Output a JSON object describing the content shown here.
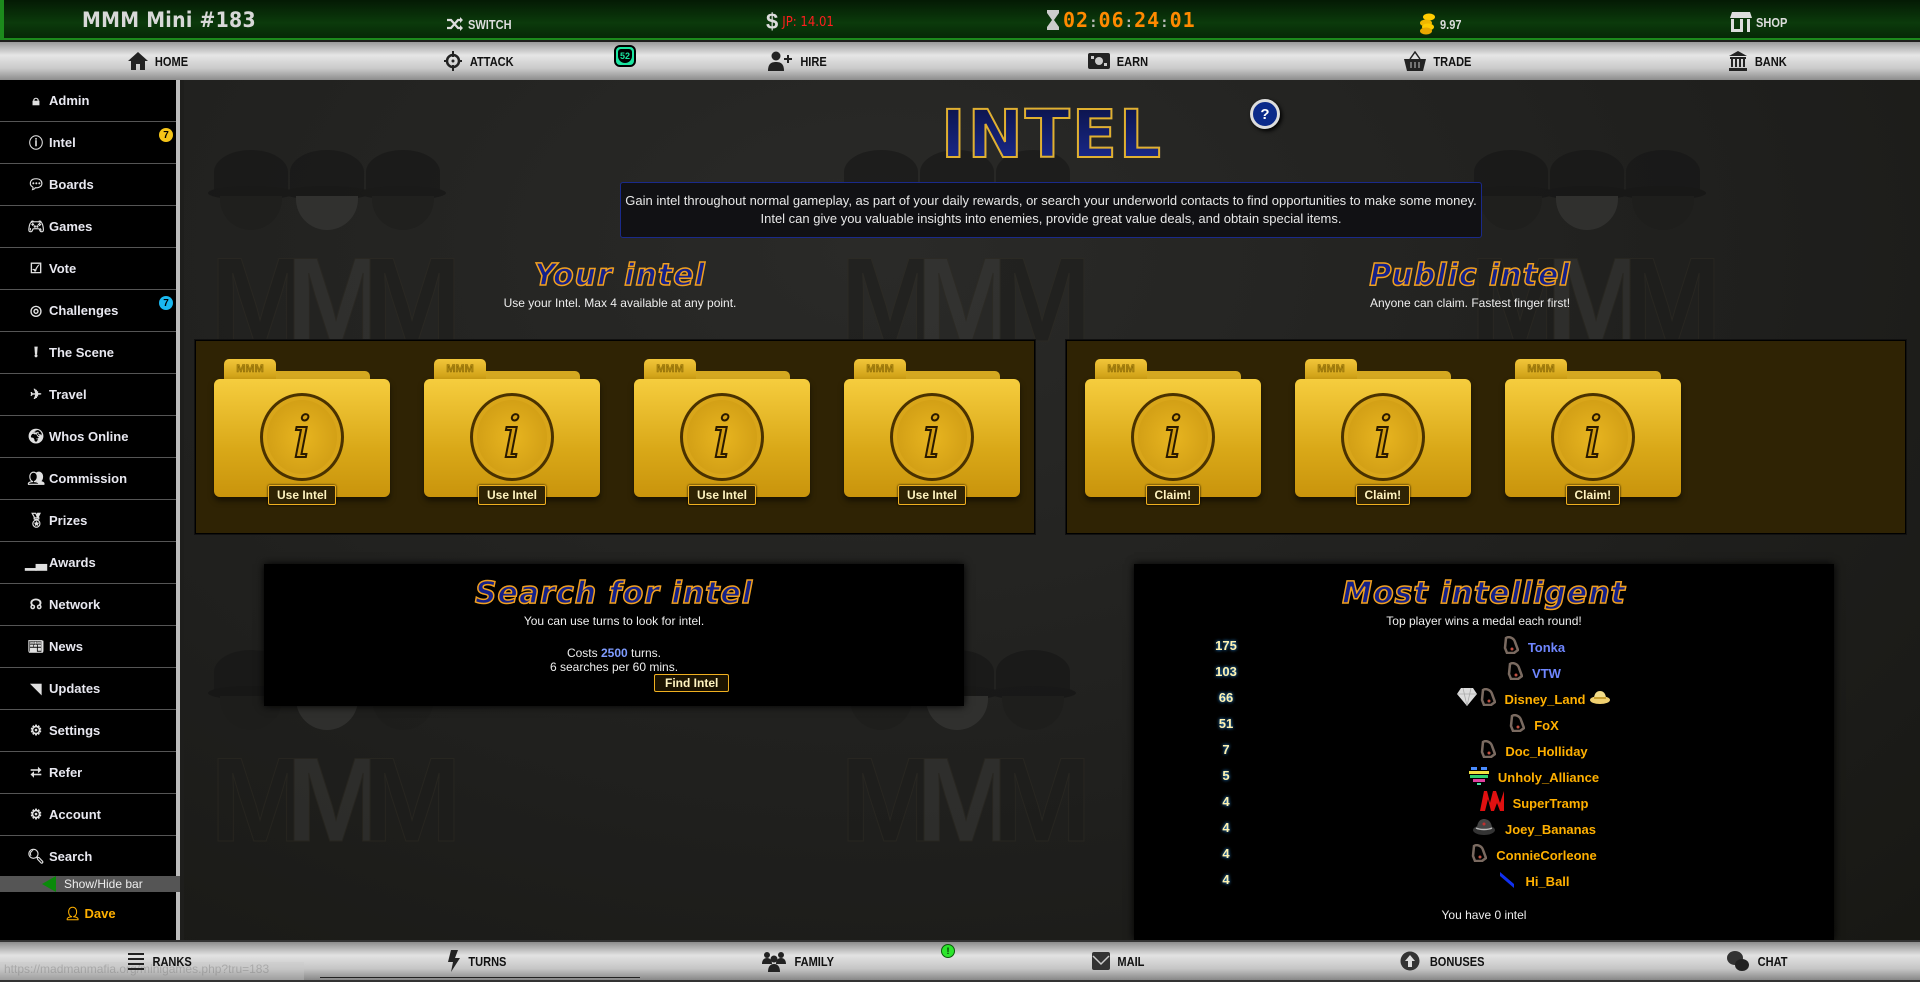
{
  "topbar": {
    "title": "MMM Mini #183",
    "switch_label": "SWITCH",
    "jackpot": "JP: 14.01",
    "timer": [
      "02",
      "06",
      "24",
      "01"
    ],
    "coins": "9.97",
    "shop_label": "SHOP"
  },
  "nav": {
    "items": [
      {
        "label": "HOME",
        "icon": "home-icon"
      },
      {
        "label": "ATTACK",
        "icon": "crosshair-icon"
      },
      {
        "label": "HIRE",
        "icon": "user-plus-icon"
      },
      {
        "label": "EARN",
        "icon": "money-icon"
      },
      {
        "label": "TRADE",
        "icon": "basket-icon"
      },
      {
        "label": "BANK",
        "icon": "bank-icon"
      }
    ],
    "attack_badge": "52"
  },
  "sidebar": {
    "items": [
      {
        "label": "Admin",
        "icon": "lock-icon"
      },
      {
        "label": "Intel",
        "icon": "info-icon",
        "badge": "7",
        "badge_color": "#f5c518"
      },
      {
        "label": "Boards",
        "icon": "speech-bubble-icon"
      },
      {
        "label": "Games",
        "icon": "gamepad-icon"
      },
      {
        "label": "Vote",
        "icon": "vote-box-icon"
      },
      {
        "label": "Challenges",
        "icon": "target-icon",
        "badge": "7",
        "badge_color": "#1ab8f0"
      },
      {
        "label": "The Scene",
        "icon": "exclamation-icon"
      },
      {
        "label": "Travel",
        "icon": "plane-icon"
      },
      {
        "label": "Whos Online",
        "icon": "globe-icon"
      },
      {
        "label": "Commission",
        "icon": "users-icon"
      },
      {
        "label": "Prizes",
        "icon": "medal-icon"
      },
      {
        "label": "Awards",
        "icon": "podium-icon"
      },
      {
        "label": "Network",
        "icon": "network-icon"
      },
      {
        "label": "News",
        "icon": "newspaper-icon"
      },
      {
        "label": "Updates",
        "icon": "rss-icon"
      },
      {
        "label": "Settings",
        "icon": "user-gear-icon"
      },
      {
        "label": "Refer",
        "icon": "share-icon"
      },
      {
        "label": "Account",
        "icon": "user-gear-icon"
      },
      {
        "label": "Search",
        "icon": "search-icon"
      }
    ],
    "toggle_label": "Show/Hide bar",
    "username": "Dave"
  },
  "main": {
    "title": "INTEL",
    "help": "?",
    "description": [
      "Gain intel throughout normal gameplay, as part of your daily rewards, or search your underworld contacts to find opportunities to make some money.",
      "Intel can give you valuable insights into enemies, provide great value deals, and obtain special items."
    ],
    "your_intel": {
      "title": "Your intel",
      "subtitle": "Use your Intel. Max 4 available at any point.",
      "folders": [
        {
          "tab": "MMM",
          "button": "Use Intel"
        },
        {
          "tab": "MMM",
          "button": "Use Intel"
        },
        {
          "tab": "MMM",
          "button": "Use Intel"
        },
        {
          "tab": "MMM",
          "button": "Use Intel"
        }
      ]
    },
    "public_intel": {
      "title": "Public intel",
      "subtitle": "Anyone can claim. Fastest finger first!",
      "folders": [
        {
          "tab": "MMM",
          "button": "Claim!"
        },
        {
          "tab": "MMM",
          "button": "Claim!"
        },
        {
          "tab": "MMM",
          "button": "Claim!"
        }
      ]
    },
    "search": {
      "title": "Search for intel",
      "subtitle": "You can use turns to look for intel.",
      "cost_prefix": "Costs ",
      "cost_value": "2500",
      "cost_suffix": " turns.",
      "rate": "6 searches per 60 mins.",
      "button": "Find Intel"
    },
    "leaderboard": {
      "title": "Most intelligent",
      "subtitle": "Top player wins a medal each round!",
      "rows": [
        {
          "score": "175",
          "name": "Tonka",
          "color": "#6f86ff",
          "icons": [
            "knuckles-icon"
          ]
        },
        {
          "score": "103",
          "name": "VTW",
          "color": "#6f86ff",
          "icons": [
            "knuckles-icon"
          ]
        },
        {
          "score": "66",
          "name": "Disney_Land",
          "color": "#ffb000",
          "icons": [
            "diamond-icon",
            "knuckles-icon"
          ],
          "suffix_icon": "fedora-icon"
        },
        {
          "score": "51",
          "name": "FoX",
          "color": "#ffb000",
          "icons": [
            "knuckles-icon"
          ]
        },
        {
          "score": "7",
          "name": "Doc_Holliday",
          "color": "#ffb000",
          "icons": [
            "knuckles-icon"
          ]
        },
        {
          "score": "5",
          "name": "Unholy_Alliance",
          "color": "#ffb000",
          "icons": [
            "pixel-heart-icon"
          ]
        },
        {
          "score": "4",
          "name": "SuperTramp",
          "color": "#ffb000",
          "icons": [
            "red-logo-icon"
          ]
        },
        {
          "score": "4",
          "name": "Joey_Bananas",
          "color": "#ffb000",
          "icons": [
            "hat-icon"
          ]
        },
        {
          "score": "4",
          "name": "ConnieCorleone",
          "color": "#ffb000",
          "icons": [
            "knuckles-icon"
          ]
        },
        {
          "score": "4",
          "name": "Hi_Ball",
          "color": "#ffb000",
          "icons": [
            "blue-flag-icon"
          ]
        }
      ],
      "footer": "You have 0 intel"
    }
  },
  "bottombar": {
    "items": [
      {
        "label": "RANKS",
        "icon": "list-icon"
      },
      {
        "label": "TURNS",
        "icon": "lightning-icon"
      },
      {
        "label": "FAMILY",
        "icon": "family-icon"
      },
      {
        "label": "MAIL",
        "icon": "mail-icon"
      },
      {
        "label": "BONUSES",
        "icon": "arrow-up-circle-icon"
      },
      {
        "label": "CHAT",
        "icon": "chat-icon"
      }
    ],
    "family_alert": "!",
    "url_tooltip": "https://madmanmafia.org/minigames.php?tru=183"
  }
}
